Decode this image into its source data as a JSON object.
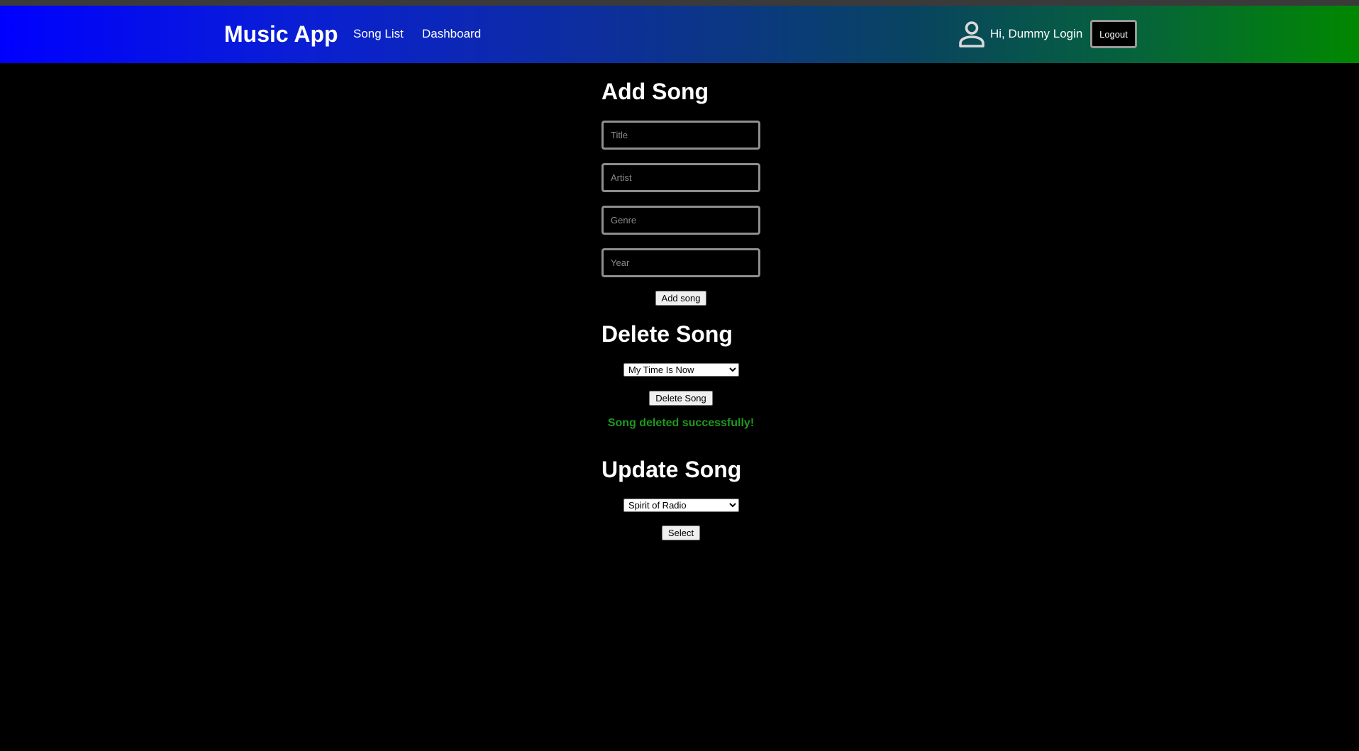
{
  "navbar": {
    "brand": "Music App",
    "links": [
      {
        "label": "Song List"
      },
      {
        "label": "Dashboard"
      }
    ],
    "greeting": "Hi, Dummy Login",
    "logout_label": "Logout",
    "user_icon": "user-icon"
  },
  "add_song": {
    "heading": "Add Song",
    "fields": [
      {
        "placeholder": "Title",
        "value": ""
      },
      {
        "placeholder": "Artist",
        "value": ""
      },
      {
        "placeholder": "Genre",
        "value": ""
      },
      {
        "placeholder": "Year",
        "value": ""
      }
    ],
    "button_label": "Add song"
  },
  "delete_song": {
    "heading": "Delete Song",
    "selected": "My Time Is Now",
    "button_label": "Delete Song",
    "status": "Song deleted successfully!"
  },
  "update_song": {
    "heading": "Update Song",
    "selected": "Spirit of Radio",
    "button_label": "Select"
  },
  "colors": {
    "background": "#000000",
    "navbar_gradient_start": "#0000ff",
    "navbar_gradient_end": "#008800",
    "success": "#1e9a1e"
  }
}
